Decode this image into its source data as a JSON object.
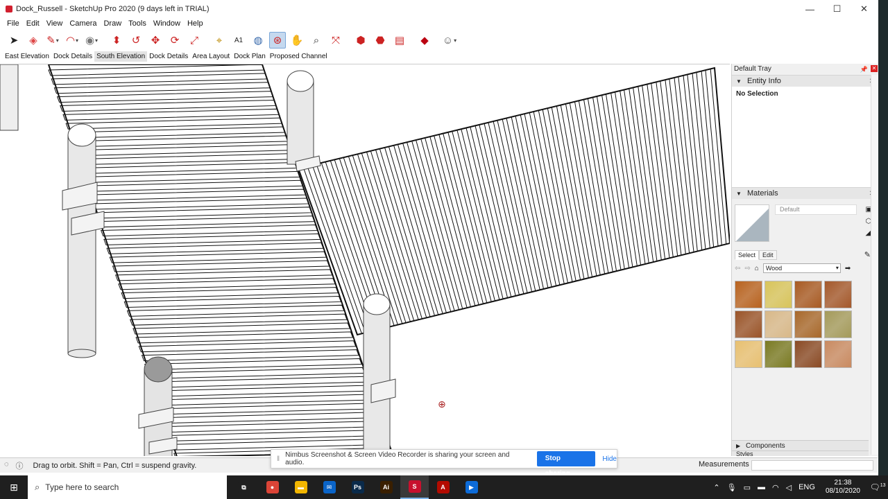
{
  "window": {
    "title": "Dock_Russell - SketchUp Pro 2020 (9 days left in TRIAL)",
    "minimize": "—",
    "maximize": "☐",
    "close": "✕"
  },
  "menu": [
    "File",
    "Edit",
    "View",
    "Camera",
    "Draw",
    "Tools",
    "Window",
    "Help"
  ],
  "toolbar": {
    "icons": [
      "select-icon",
      "eraser-icon",
      "pencil-icon",
      "arc-icon",
      "shape-icon",
      "push-pull-icon",
      "follow-me-icon",
      "move-icon",
      "rotate-icon",
      "scale-icon",
      "tape-measure-icon",
      "text-icon",
      "paint-bucket-icon",
      "orbit-icon",
      "pan-icon",
      "zoom-icon",
      "zoom-extents-icon",
      "warehouse-icon",
      "extension-warehouse-icon",
      "layout-icon",
      "ruby-icon",
      "profile-icon"
    ]
  },
  "scenes": [
    "East Elevation",
    "Dock Details",
    "South Elevation",
    "Dock Details",
    "Area Layout",
    "Dock Plan",
    "Proposed Channel"
  ],
  "selected_scene_index": 2,
  "tray": {
    "title": "Default Tray",
    "entity_info": {
      "label": "Entity Info",
      "value": "No Selection"
    },
    "materials": {
      "label": "Materials",
      "name_placeholder": "Default",
      "tabs": [
        "Select",
        "Edit"
      ],
      "library": "Wood",
      "swatch_colors": [
        "#b8621e",
        "#d8c45a",
        "#a85a22",
        "#a4582a",
        "#9a5428",
        "#d8b888",
        "#a8682a",
        "#a49a5a",
        "#e8c070",
        "#7a7a22",
        "#8a4a24",
        "#c98a60"
      ]
    },
    "components_label": "Components",
    "styles_label": "Styles"
  },
  "status": {
    "text": "Drag to orbit. Shift = Pan, Ctrl = suspend gravity.",
    "measurements_label": "Measurements"
  },
  "sharing": {
    "text": "Nimbus Screenshot & Screen Video Recorder is sharing your screen and audio.",
    "stop_label": "Stop sharing",
    "hide_label": "Hide"
  },
  "taskbar": {
    "search_placeholder": "Type here to search",
    "apps": [
      {
        "name": "task-view-icon",
        "label": "⧉",
        "color": "#1f1f1f"
      },
      {
        "name": "chrome-icon",
        "label": "●",
        "color": "#db4437"
      },
      {
        "name": "file-explorer-icon",
        "label": "▬",
        "color": "#f2b600"
      },
      {
        "name": "mail-icon",
        "label": "✉",
        "color": "#0a64c8"
      },
      {
        "name": "photoshop-icon",
        "label": "Ps",
        "color": "#0a2a4a"
      },
      {
        "name": "illustrator-icon",
        "label": "Ai",
        "color": "#3a1f00"
      },
      {
        "name": "sketchup-icon",
        "label": "S",
        "color": "#c8102e"
      },
      {
        "name": "pdf-icon",
        "label": "A",
        "color": "#b30b00"
      },
      {
        "name": "video-app-icon",
        "label": "▶",
        "color": "#0d6bd8"
      }
    ],
    "language": "ENG",
    "time": "21:38",
    "date": "08/10/2020",
    "notifications": "13"
  }
}
